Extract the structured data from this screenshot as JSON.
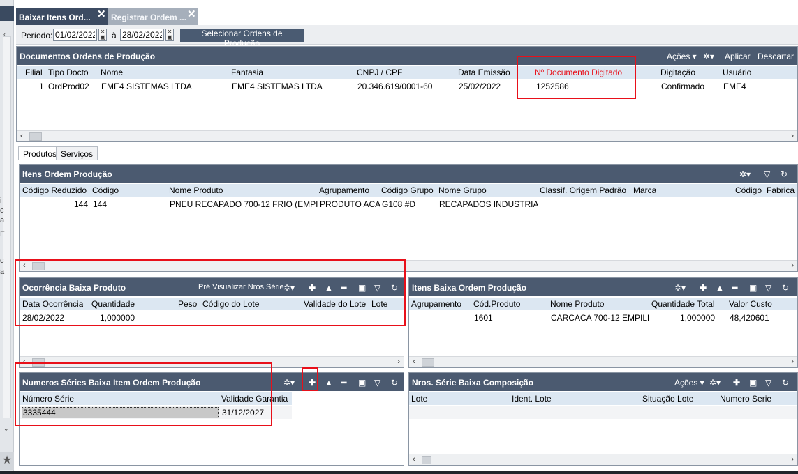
{
  "tabs": [
    {
      "label": "Baixar Itens Ord..."
    },
    {
      "label": "Registrar Ordem ..."
    }
  ],
  "toolbar": {
    "period_label": "Período:",
    "date_from": "01/02/2022",
    "between_label": "à",
    "date_to": "28/02/2022",
    "select_button": "Selecionar Ordens de Produção"
  },
  "documents": {
    "title": "Documentos Ordens de Produção",
    "actions": {
      "acoes": "Ações ▾",
      "apply": "Aplicar",
      "discard": "Descartar"
    },
    "columns": [
      "Filial",
      "Tipo Docto",
      "Nome",
      "Fantasia",
      "CNPJ / CPF",
      "Data Emissão",
      "Nº Documento Digitado",
      "Digitação",
      "Usuário"
    ],
    "rows": [
      [
        "1",
        "OrdProd02",
        "EME4 SISTEMAS LTDA",
        "EME4 SISTEMAS LTDA",
        "20.346.619/0001-60",
        "25/02/2022",
        "1252586",
        "Confirmado",
        "EME4"
      ]
    ]
  },
  "subtabs": [
    {
      "label": "Produtos"
    },
    {
      "label": "Serviços"
    }
  ],
  "items": {
    "title": "Itens Ordem Produção",
    "columns": [
      "Código Reduzido",
      "Código",
      "Nome Produto",
      "Agrupamento",
      "Código Grupo",
      "Nome Grupo",
      "Classif. Origem Padrão",
      "Marca",
      "Código",
      "Fabrica"
    ],
    "rows": [
      [
        "144",
        "144",
        "PNEU RECAPADO 700-12 FRIO (EMPI",
        "PRODUTO ACA",
        "G108 #D",
        "RECAPADOS INDUSTRIA",
        "",
        "",
        "",
        ""
      ]
    ]
  },
  "ocorrencia": {
    "title": "Ocorrência Baixa Produto",
    "preview_label": "Pré Visualizar Nros Série",
    "columns": [
      "Data Ocorrência",
      "Quantidade",
      "Peso",
      "Código do Lote",
      "Validade do Lote",
      "Lote"
    ],
    "rows": [
      [
        "28/02/2022",
        "1,000000",
        "",
        "",
        "",
        ""
      ]
    ]
  },
  "itens_baixa": {
    "title": "Itens Baixa Ordem Produção",
    "columns": [
      "Agrupamento",
      "Cód.Produto",
      "Nome Produto",
      "Quantidade Total",
      "Valor Custo"
    ],
    "rows": [
      [
        "",
        "1601",
        "CARCACA 700-12 EMPILH",
        "1,000000",
        "48,420601"
      ]
    ]
  },
  "numeros_serie": {
    "title": "Numeros Séries Baixa Item Ordem Produção",
    "columns": [
      "Número Série",
      "Validade Garantia"
    ],
    "rows": [
      [
        "3335444",
        "31/12/2027"
      ]
    ]
  },
  "nros_composicao": {
    "title": "Nros. Série Baixa Composição",
    "actions_label": "Ações ▾",
    "columns": [
      "Lote",
      "Ident. Lote",
      "Situação Lote",
      "Numero Serie"
    ]
  },
  "colors": {
    "header_bg": "#4b5a70",
    "column_header_bg": "#dce7f2",
    "highlight_red": "#e8101a",
    "red_text": "#e8101a"
  }
}
